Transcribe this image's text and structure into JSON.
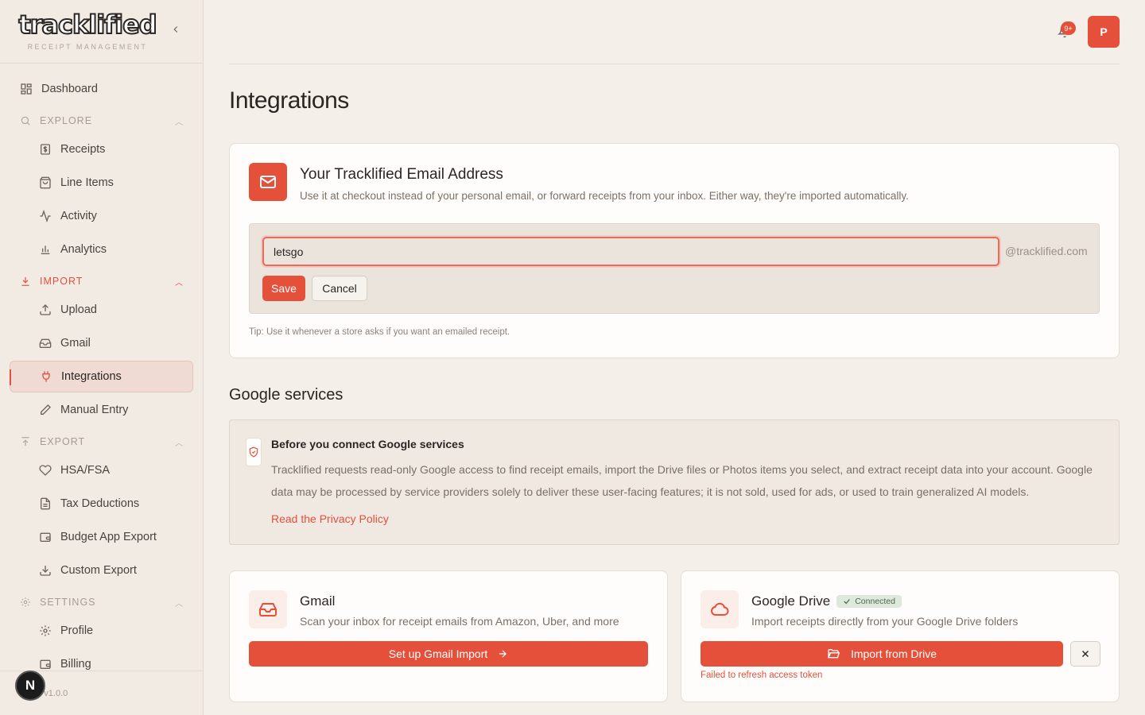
{
  "brand": {
    "logo": "tracklified",
    "tagline": "RECEIPT MANAGEMENT"
  },
  "sidebar": {
    "dashboard": "Dashboard",
    "explore": {
      "label": "EXPLORE",
      "items": [
        "Receipts",
        "Line Items",
        "Activity",
        "Analytics"
      ]
    },
    "import": {
      "label": "IMPORT",
      "items": [
        "Upload",
        "Gmail",
        "Integrations",
        "Manual Entry"
      ]
    },
    "export": {
      "label": "EXPORT",
      "items": [
        "HSA/FSA",
        "Tax Deductions",
        "Budget App Export",
        "Custom Export"
      ]
    },
    "settings": {
      "label": "SETTINGS",
      "items": [
        "Profile",
        "Billing"
      ]
    },
    "active_item": "Integrations",
    "version": "ed v1.0.0",
    "n_badge": "N"
  },
  "topbar": {
    "notification_count": "9+",
    "avatar_initial": "P"
  },
  "page": {
    "title": "Integrations"
  },
  "email_card": {
    "title": "Your Tracklified Email Address",
    "description": "Use it at checkout instead of your personal email, or forward receipts from your inbox. Either way, they're imported automatically.",
    "input_value": "letsgo",
    "suffix": "@tracklified.com",
    "save_label": "Save",
    "cancel_label": "Cancel",
    "tip": "Tip: Use it whenever a store asks if you want an emailed receipt."
  },
  "google": {
    "section_title": "Google services",
    "notice_title": "Before you connect Google services",
    "notice_body": "Tracklified requests read-only Google access to find receipt emails, import the Drive files or Photos items you select, and extract receipt data into your account. Google data may be processed by service providers solely to deliver these user-facing features; it is not sold, used for ads, or used to train generalized AI models.",
    "privacy_link": "Read the Privacy Policy"
  },
  "gmail_card": {
    "title": "Gmail",
    "description": "Scan your inbox for receipt emails from Amazon, Uber, and more",
    "button": "Set up Gmail Import"
  },
  "drive_card": {
    "title": "Google Drive",
    "status": "Connected",
    "description": "Import receipts directly from your Google Drive folders",
    "button": "Import from Drive",
    "error": "Failed to refresh access token"
  },
  "colors": {
    "accent": "#e4503a",
    "background": "#f4efe9",
    "sidebar": "#f1ebe4",
    "connected_badge": "#dfe8dc"
  }
}
